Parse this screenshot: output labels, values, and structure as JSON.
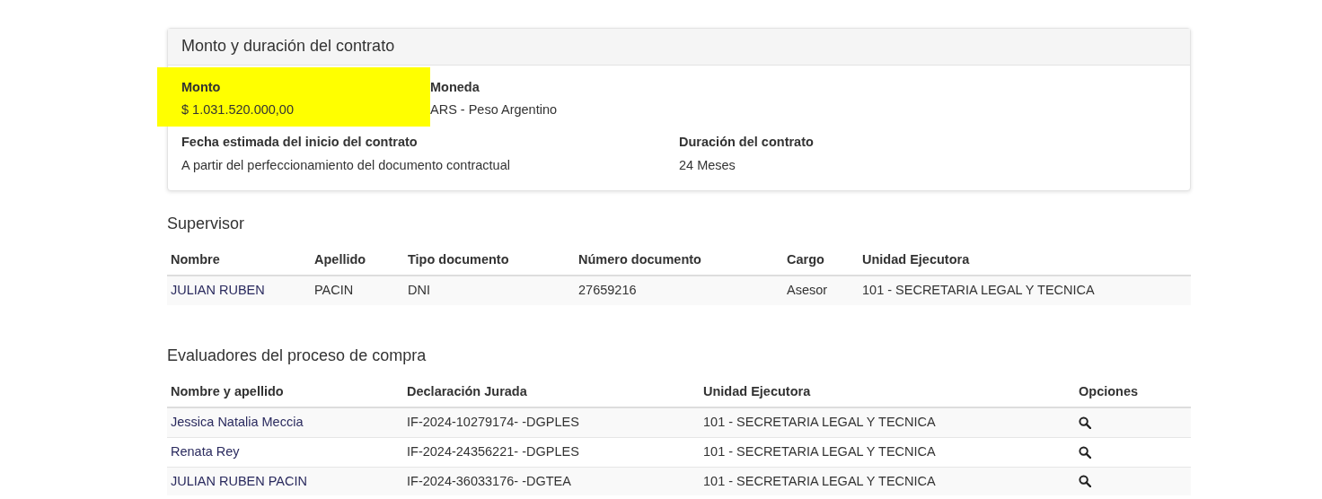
{
  "contract_card": {
    "title": "Monto y duración del contrato",
    "field_rows": [
      [
        {
          "label": "Monto",
          "value": "$ 1.031.520.000,00",
          "highlighted": true
        },
        {
          "label": "Moneda",
          "value": "ARS - Peso Argentino",
          "highlighted": false
        }
      ],
      [
        {
          "label": "Fecha estimada del inicio del contrato",
          "value": "A partir del perfeccionamiento del documento contractual",
          "highlighted": false
        },
        {
          "label": "Duración del contrato",
          "value": "24 Meses",
          "highlighted": false
        }
      ]
    ]
  },
  "supervisor": {
    "title": "Supervisor",
    "columns": [
      "Nombre",
      "Apellido",
      "Tipo documento",
      "Número documento",
      "Cargo",
      "Unidad Ejecutora"
    ],
    "rows": [
      [
        "JULIAN RUBEN",
        "PACIN",
        "DNI",
        "27659216",
        "Asesor",
        "101 - SECRETARIA LEGAL Y TECNICA"
      ]
    ]
  },
  "evaluators": {
    "title": "Evaluadores del proceso de compra",
    "columns": [
      "Nombre y apellido",
      "Declaración Jurada",
      "Unidad Ejecutora",
      "Opciones"
    ],
    "rows": [
      [
        "Jessica Natalia Meccia",
        "IF-2024-10279174- -DGPLES",
        "101 - SECRETARIA LEGAL Y TECNICA"
      ],
      [
        "Renata Rey",
        "IF-2024-24356221- -DGPLES",
        "101 - SECRETARIA LEGAL Y TECNICA"
      ],
      [
        "JULIAN RUBEN PACIN",
        "IF-2024-36033176- -DGTEA",
        "101 - SECRETARIA LEGAL Y TECNICA"
      ]
    ]
  }
}
